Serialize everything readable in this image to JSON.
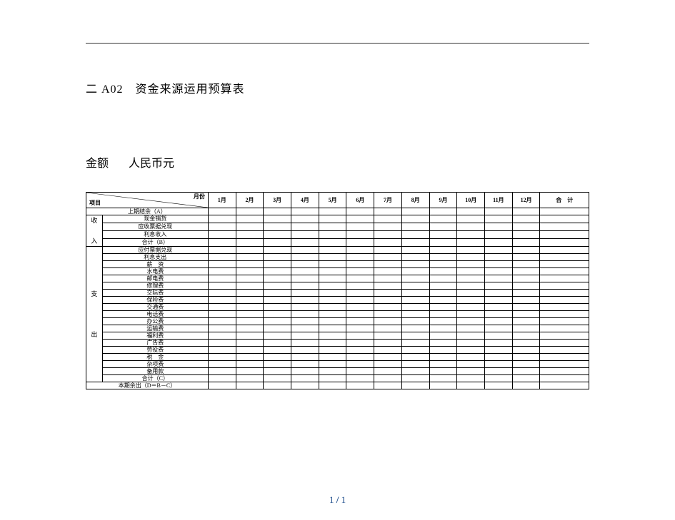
{
  "doc": {
    "title": "二 A02　资金来源运用预算表",
    "amount_label": "金额",
    "currency": "人民币元",
    "page_current": "1",
    "page_sep": "/",
    "page_total": "1"
  },
  "header": {
    "corner_left": "项目",
    "corner_right": "月份",
    "months": [
      "1月",
      "2月",
      "3月",
      "4月",
      "5月",
      "6月",
      "7月",
      "8月",
      "9月",
      "10月",
      "11月",
      "12月"
    ],
    "total": "合　计"
  },
  "rows": {
    "opening_balance": "上期结余（A）",
    "income_group": "收\n\n入",
    "income_items": [
      "现金销货",
      "应收票据兑现",
      "利息收入",
      "合计（B）"
    ],
    "expense_group": "支\n\n\n\n出",
    "expense_items": [
      "应付票据兑现",
      "利息支出",
      "薪　资",
      "水电费",
      "邮电费",
      "修理费",
      "交际费",
      "保险费",
      "交通费",
      "电话费",
      "办公费",
      "运输费",
      "福利费",
      "广告费",
      "劳役费",
      "税　金",
      "杂项费",
      "备用款",
      "合计（C）"
    ],
    "closing_balance": "本期余出（D＝B－C）"
  }
}
